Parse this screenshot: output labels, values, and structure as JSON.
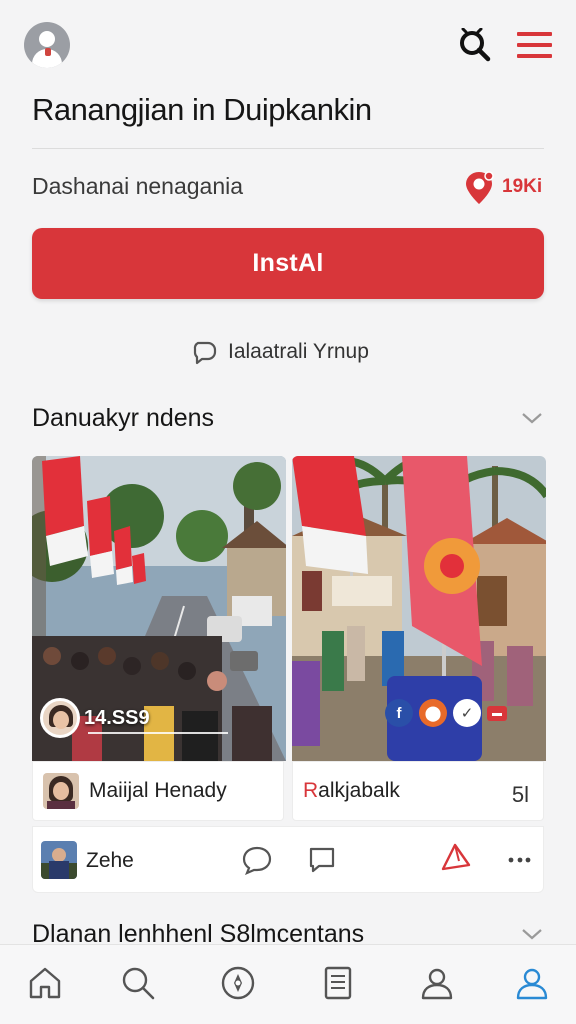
{
  "header": {
    "title": "Ranangjian in Duipkankin"
  },
  "summary": {
    "subtitle": "Dashanai nenagania",
    "count": "19Ki"
  },
  "install": {
    "label": "InstAl"
  },
  "group_link": {
    "label": "Ialaatrali Yrnup"
  },
  "section1": {
    "title": "Danuakyr ndens",
    "photo_left": {
      "viewer_count": "14.SS9"
    },
    "author_left": {
      "name": "Maiijal Henady"
    },
    "author_right": {
      "name_red": "R",
      "name_rest": "alkjabalk",
      "count": "5l"
    },
    "post": {
      "name": "Zehe"
    }
  },
  "section2": {
    "title": "Dlanan lenhhenl S8lmcentans"
  },
  "colors": {
    "accent_red": "#d8363a",
    "background": "#f4f4f5",
    "card": "#ffffff"
  },
  "icons": {
    "profile": "avatar-icon",
    "search": "search-icon",
    "menu": "hamburger-menu-icon",
    "pin": "location-pin-icon",
    "group": "chat-bubble-icon",
    "chevron": "chevron-down-icon",
    "nav": [
      "home-icon",
      "search-icon",
      "compass-icon",
      "document-icon",
      "profile-icon",
      "account-icon"
    ]
  }
}
